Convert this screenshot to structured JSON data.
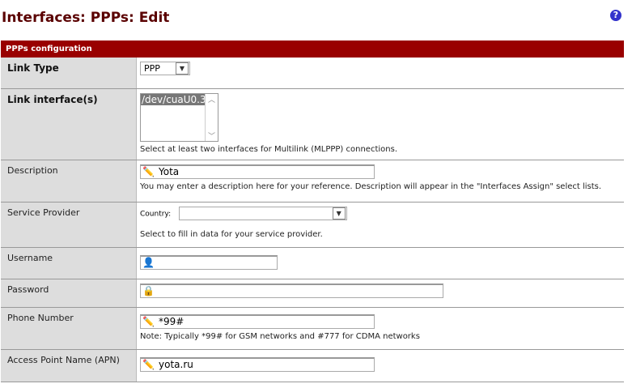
{
  "page": {
    "title": "Interfaces: PPPs: Edit",
    "help_icon": "?"
  },
  "section": {
    "title": "PPPs configuration"
  },
  "link_type": {
    "label": "Link Type",
    "value": "PPP"
  },
  "link_interfaces": {
    "label": "Link interface(s)",
    "selected": "/dev/cuaU0.3",
    "note": "Select at least two interfaces for Multilink (MLPPP) connections."
  },
  "description": {
    "label": "Description",
    "value": "Yota",
    "note": "You may enter a description here for your reference. Description will appear in the \"Interfaces Assign\" select lists."
  },
  "service_provider": {
    "label": "Service Provider",
    "country_label": "Country:",
    "country_value": "",
    "note": "Select to fill in data for your service provider."
  },
  "username": {
    "label": "Username",
    "value": ""
  },
  "password": {
    "label": "Password",
    "value": ""
  },
  "phone": {
    "label": "Phone Number",
    "value": "*99#",
    "note": "Note: Typically *99# for GSM networks and #777 for CDMA networks"
  },
  "apn": {
    "label": "Access Point Name (APN)",
    "value": "yota.ru"
  }
}
